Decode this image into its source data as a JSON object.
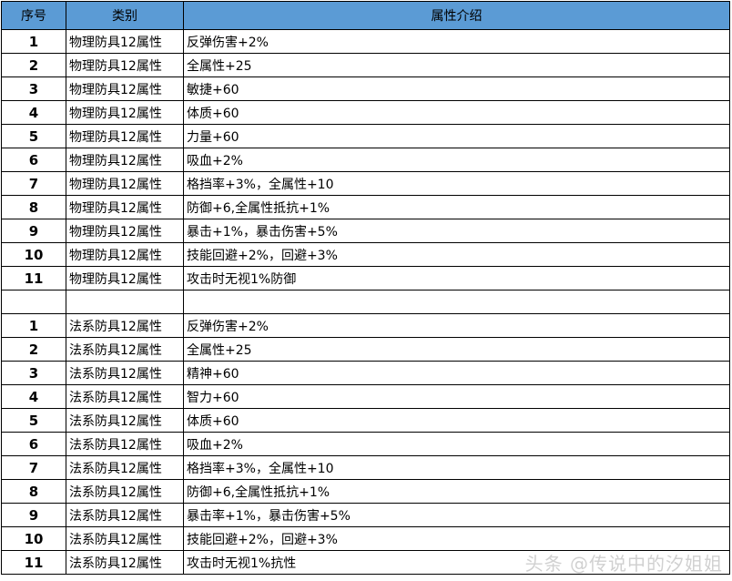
{
  "header": {
    "col1": "序号",
    "col2": "类别",
    "col3": "属性介绍"
  },
  "rows": [
    {
      "no": "1",
      "cat": "物理防具12属性",
      "attr": "反弹伤害+2%"
    },
    {
      "no": "2",
      "cat": "物理防具12属性",
      "attr": "全属性+25"
    },
    {
      "no": "3",
      "cat": "物理防具12属性",
      "attr": "敏捷+60"
    },
    {
      "no": "4",
      "cat": "物理防具12属性",
      "attr": "体质+60"
    },
    {
      "no": "5",
      "cat": "物理防具12属性",
      "attr": "力量+60"
    },
    {
      "no": "6",
      "cat": "物理防具12属性",
      "attr": "吸血+2%"
    },
    {
      "no": "7",
      "cat": "物理防具12属性",
      "attr": "格挡率+3%，全属性+10"
    },
    {
      "no": "8",
      "cat": "物理防具12属性",
      "attr": "防御+6,全属性抵抗+1%"
    },
    {
      "no": "9",
      "cat": "物理防具12属性",
      "attr": "暴击+1%，暴击伤害+5%"
    },
    {
      "no": "10",
      "cat": "物理防具12属性",
      "attr": "技能回避+2%，回避+3%"
    },
    {
      "no": "11",
      "cat": "物理防具12属性",
      "attr": "攻击时无视1%防御"
    },
    {
      "no": "",
      "cat": "",
      "attr": ""
    },
    {
      "no": "1",
      "cat": "法系防具12属性",
      "attr": "反弹伤害+2%"
    },
    {
      "no": "2",
      "cat": "法系防具12属性",
      "attr": "全属性+25"
    },
    {
      "no": "3",
      "cat": "法系防具12属性",
      "attr": "精神+60"
    },
    {
      "no": "4",
      "cat": "法系防具12属性",
      "attr": "智力+60"
    },
    {
      "no": "5",
      "cat": "法系防具12属性",
      "attr": "体质+60"
    },
    {
      "no": "6",
      "cat": "法系防具12属性",
      "attr": "吸血+2%"
    },
    {
      "no": "7",
      "cat": "法系防具12属性",
      "attr": "格挡率+3%，全属性+10"
    },
    {
      "no": "8",
      "cat": "法系防具12属性",
      "attr": "防御+6,全属性抵抗+1%"
    },
    {
      "no": "9",
      "cat": "法系防具12属性",
      "attr": "暴击率+1%，暴击伤害+5%"
    },
    {
      "no": "10",
      "cat": "法系防具12属性",
      "attr": "技能回避+2%，回避+3%"
    },
    {
      "no": "11",
      "cat": "法系防具12属性",
      "attr": "攻击时无视1%抗性"
    }
  ],
  "watermark": "头条 @传说中的汐姐姐"
}
